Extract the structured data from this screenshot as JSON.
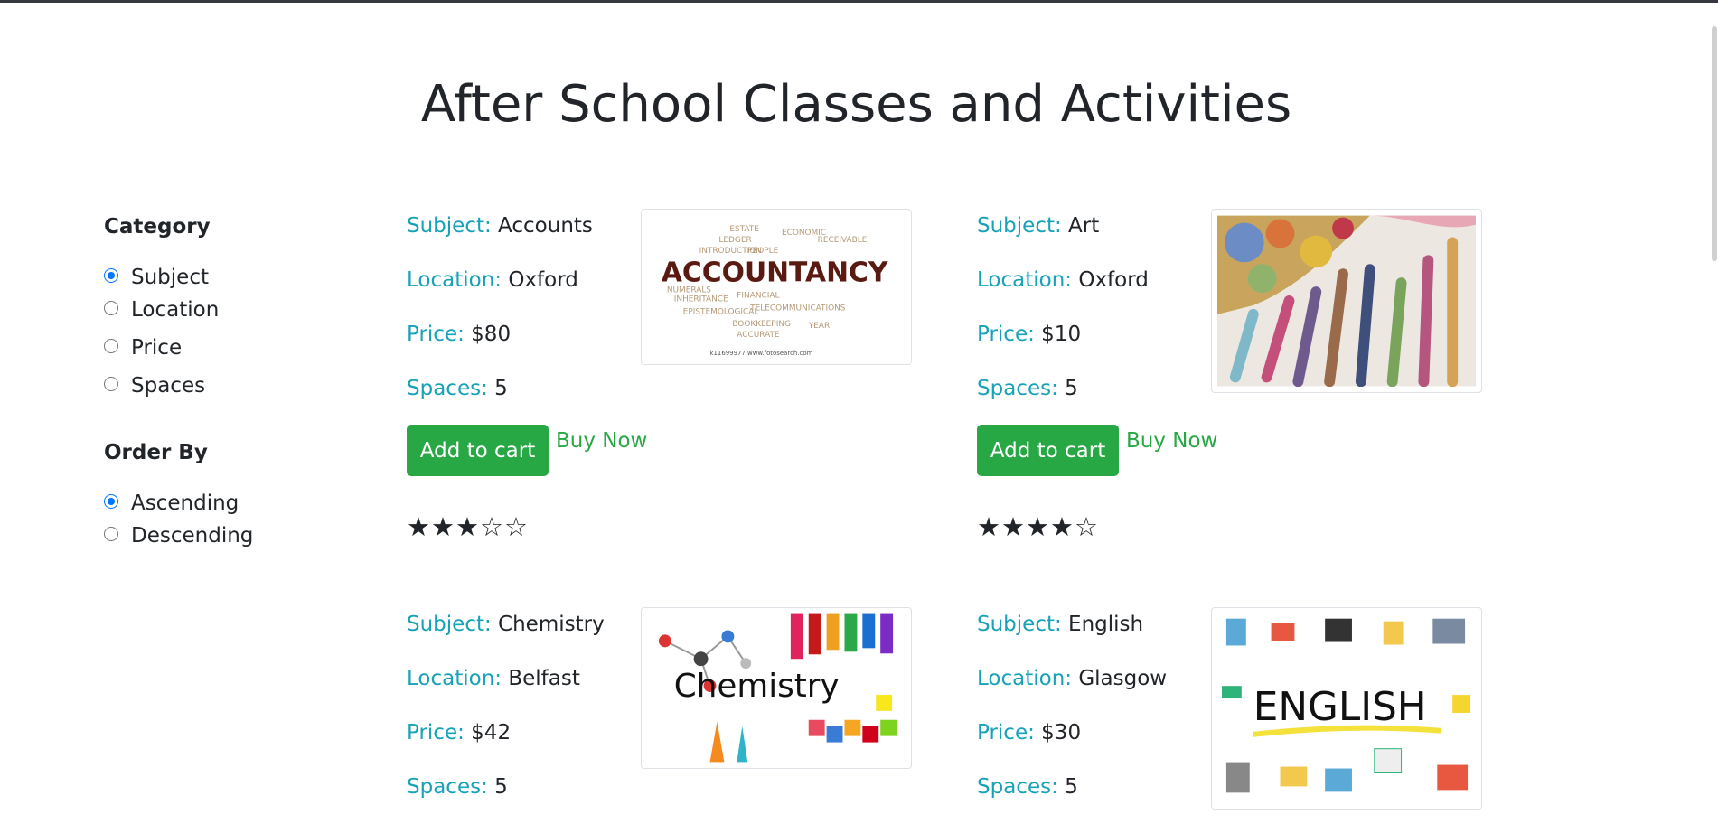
{
  "page": {
    "title": "After School Classes and Activities"
  },
  "filters": {
    "category": {
      "heading": "Category",
      "options": [
        "Subject",
        "Location",
        "Price",
        "Spaces"
      ],
      "selected": "Subject"
    },
    "order": {
      "heading": "Order By",
      "options": [
        "Ascending",
        "Descending"
      ],
      "selected": "Ascending"
    }
  },
  "labels": {
    "subject": "Subject:",
    "location": "Location:",
    "price": "Price:",
    "spaces": "Spaces:",
    "add_to_cart": "Add to cart",
    "buy_now": "Buy Now"
  },
  "lessons": [
    {
      "subject": "Accounts",
      "location": "Oxford",
      "price": "$80",
      "spaces": "5",
      "rating": 3,
      "rating_max": 5,
      "image_text": "ACCOUNTANCY"
    },
    {
      "subject": "Art",
      "location": "Oxford",
      "price": "$10",
      "spaces": "5",
      "rating": 4,
      "rating_max": 5
    },
    {
      "subject": "Chemistry",
      "location": "Belfast",
      "price": "$42",
      "spaces": "5",
      "image_text": "Chemistry"
    },
    {
      "subject": "English",
      "location": "Glasgow",
      "price": "$30",
      "spaces": "5",
      "image_text": "ENGLISH"
    }
  ],
  "colors": {
    "accent_label": "#17a2b8",
    "button_green": "#28a745",
    "radio_blue": "#0075ff",
    "text": "#212529"
  },
  "icons": {
    "star_filled": "star-filled-icon",
    "star_empty": "star-empty-icon"
  }
}
